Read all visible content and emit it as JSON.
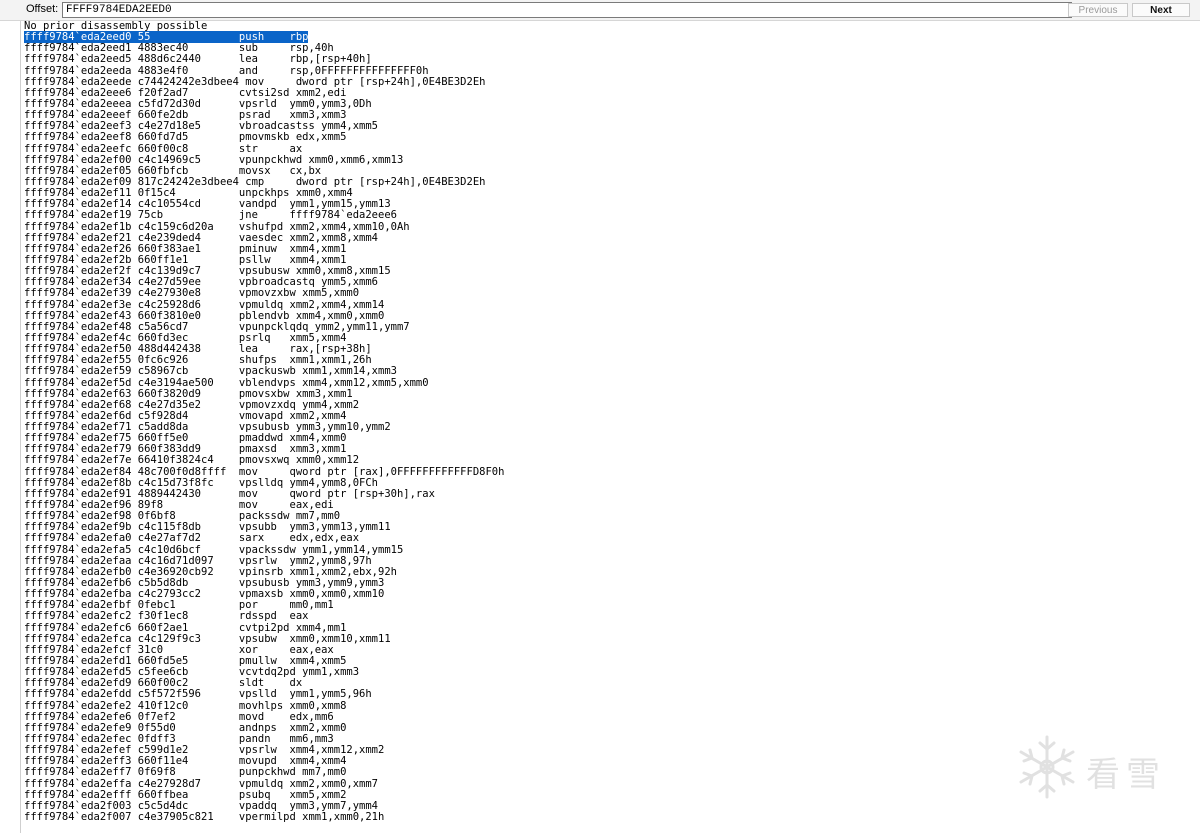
{
  "toolbar": {
    "offset_label": "Offset:",
    "offset_value": "FFFF9784EDA2EED0",
    "previous_label": "Previous",
    "next_label": "Next"
  },
  "listing": {
    "header": "No prior disassembly possible",
    "selected_index": 0,
    "lines": [
      "ffff9784`eda2eed0 55              push    rbp",
      "ffff9784`eda2eed1 4883ec40        sub     rsp,40h",
      "ffff9784`eda2eed5 488d6c2440      lea     rbp,[rsp+40h]",
      "ffff9784`eda2eeda 4883e4f0        and     rsp,0FFFFFFFFFFFFFFF0h",
      "ffff9784`eda2eede c74424242e3dbee4 mov     dword ptr [rsp+24h],0E4BE3D2Eh",
      "ffff9784`eda2eee6 f20f2ad7        cvtsi2sd xmm2,edi",
      "ffff9784`eda2eeea c5fd72d30d      vpsrld  ymm0,ymm3,0Dh",
      "ffff9784`eda2eeef 660fe2db        psrad   xmm3,xmm3",
      "ffff9784`eda2eef3 c4e27d18e5      vbroadcastss ymm4,xmm5",
      "ffff9784`eda2eef8 660fd7d5        pmovmskb edx,xmm5",
      "ffff9784`eda2eefc 660f00c8        str     ax",
      "ffff9784`eda2ef00 c4c14969c5      vpunpckhwd xmm0,xmm6,xmm13",
      "ffff9784`eda2ef05 660fbfcb        movsx   cx,bx",
      "ffff9784`eda2ef09 817c24242e3dbee4 cmp     dword ptr [rsp+24h],0E4BE3D2Eh",
      "ffff9784`eda2ef11 0f15c4          unpckhps xmm0,xmm4",
      "ffff9784`eda2ef14 c4c10554cd      vandpd  ymm1,ymm15,ymm13",
      "ffff9784`eda2ef19 75cb            jne     ffff9784`eda2eee6",
      "ffff9784`eda2ef1b c4c159c6d20a    vshufpd xmm2,xmm4,xmm10,0Ah",
      "ffff9784`eda2ef21 c4e239ded4      vaesdec xmm2,xmm8,xmm4",
      "ffff9784`eda2ef26 660f383ae1      pminuw  xmm4,xmm1",
      "ffff9784`eda2ef2b 660ff1e1        psllw   xmm4,xmm1",
      "ffff9784`eda2ef2f c4c139d9c7      vpsubusw xmm0,xmm8,xmm15",
      "ffff9784`eda2ef34 c4e27d59ee      vpbroadcastq ymm5,xmm6",
      "ffff9784`eda2ef39 c4e27930e8      vpmovzxbw xmm5,xmm0",
      "ffff9784`eda2ef3e c4c25928d6      vpmuldq xmm2,xmm4,xmm14",
      "ffff9784`eda2ef43 660f3810e0      pblendvb xmm4,xmm0,xmm0",
      "ffff9784`eda2ef48 c5a56cd7        vpunpcklqdq ymm2,ymm11,ymm7",
      "ffff9784`eda2ef4c 660fd3ec        psrlq   xmm5,xmm4",
      "ffff9784`eda2ef50 488d442438      lea     rax,[rsp+38h]",
      "ffff9784`eda2ef55 0fc6c926        shufps  xmm1,xmm1,26h",
      "ffff9784`eda2ef59 c58967cb        vpackuswb xmm1,xmm14,xmm3",
      "ffff9784`eda2ef5d c4e3194ae500    vblendvps xmm4,xmm12,xmm5,xmm0",
      "ffff9784`eda2ef63 660f3820d9      pmovsxbw xmm3,xmm1",
      "ffff9784`eda2ef68 c4e27d35e2      vpmovzxdq ymm4,xmm2",
      "ffff9784`eda2ef6d c5f928d4        vmovapd xmm2,xmm4",
      "ffff9784`eda2ef71 c5add8da        vpsubusb ymm3,ymm10,ymm2",
      "ffff9784`eda2ef75 660ff5e0        pmaddwd xmm4,xmm0",
      "ffff9784`eda2ef79 660f383dd9      pmaxsd  xmm3,xmm1",
      "ffff9784`eda2ef7e 66410f3824c4    pmovsxwq xmm0,xmm12",
      "ffff9784`eda2ef84 48c700f0d8ffff  mov     qword ptr [rax],0FFFFFFFFFFFFD8F0h",
      "ffff9784`eda2ef8b c4c15d73f8fc    vpslldq ymm4,ymm8,0FCh",
      "ffff9784`eda2ef91 4889442430      mov     qword ptr [rsp+30h],rax",
      "ffff9784`eda2ef96 89f8            mov     eax,edi",
      "ffff9784`eda2ef98 0f6bf8          packssdw mm7,mm0",
      "ffff9784`eda2ef9b c4c115f8db      vpsubb  ymm3,ymm13,ymm11",
      "ffff9784`eda2efa0 c4e27af7d2      sarx    edx,edx,eax",
      "ffff9784`eda2efa5 c4c10d6bcf      vpackssdw ymm1,ymm14,ymm15",
      "ffff9784`eda2efaa c4c16d71d097    vpsrlw  ymm2,ymm8,97h",
      "ffff9784`eda2efb0 c4e36920cb92    vpinsrb xmm1,xmm2,ebx,92h",
      "ffff9784`eda2efb6 c5b5d8db        vpsubusb ymm3,ymm9,ymm3",
      "ffff9784`eda2efba c4c2793cc2      vpmaxsb xmm0,xmm0,xmm10",
      "ffff9784`eda2efbf 0febc1          por     mm0,mm1",
      "ffff9784`eda2efc2 f30f1ec8        rdsspd  eax",
      "ffff9784`eda2efc6 660f2ae1        cvtpi2pd xmm4,mm1",
      "ffff9784`eda2efca c4c129f9c3      vpsubw  xmm0,xmm10,xmm11",
      "ffff9784`eda2efcf 31c0            xor     eax,eax",
      "ffff9784`eda2efd1 660fd5e5        pmullw  xmm4,xmm5",
      "ffff9784`eda2efd5 c5fee6cb        vcvtdq2pd ymm1,xmm3",
      "ffff9784`eda2efd9 660f00c2        sldt    dx",
      "ffff9784`eda2efdd c5f572f596      vpslld  ymm1,ymm5,96h",
      "ffff9784`eda2efe2 410f12c0        movhlps xmm0,xmm8",
      "ffff9784`eda2efe6 0f7ef2          movd    edx,mm6",
      "ffff9784`eda2efe9 0f55d0          andnps  xmm2,xmm0",
      "ffff9784`eda2efec 0fdff3          pandn   mm6,mm3",
      "ffff9784`eda2efef c599d1e2        vpsrlw  xmm4,xmm12,xmm2",
      "ffff9784`eda2eff3 660f11e4        movupd  xmm4,xmm4",
      "ffff9784`eda2eff7 0f69f8          punpckhwd mm7,mm0",
      "ffff9784`eda2effa c4e27928d7      vpmuldq xmm2,xmm0,xmm7",
      "ffff9784`eda2efff 660ffbea        psubq   xmm5,xmm2",
      "ffff9784`eda2f003 c5c5d4dc        vpaddq  ymm3,ymm7,ymm4",
      "ffff9784`eda2f007 c4e37905c821    vpermilpd xmm1,xmm0,21h"
    ]
  },
  "watermark": {
    "icon": "snowflake-logo-icon",
    "text": "看雪",
    "color": "#c9c9c9"
  },
  "colors": {
    "selection": "#0a64c8",
    "selection_text": "#ffffff"
  }
}
